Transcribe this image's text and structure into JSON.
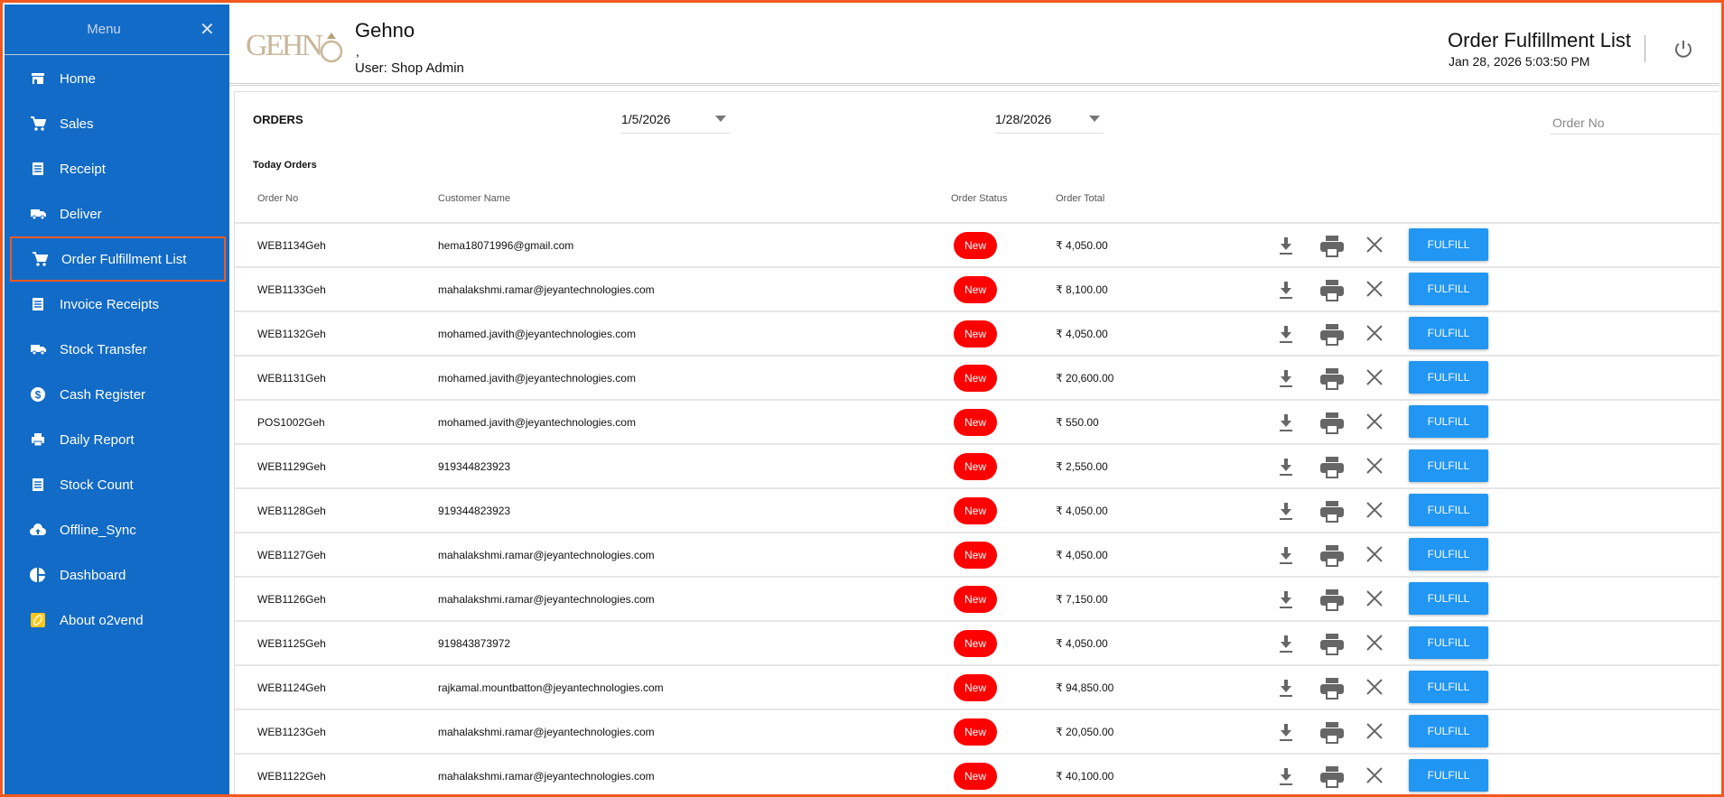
{
  "sidebar": {
    "title": "Menu",
    "close_icon": "close-icon",
    "items": [
      {
        "label": "Home",
        "icon": "store-icon"
      },
      {
        "label": "Sales",
        "icon": "cart-icon"
      },
      {
        "label": "Receipt",
        "icon": "receipt-icon"
      },
      {
        "label": "Deliver",
        "icon": "truck-icon"
      },
      {
        "label": "Order Fulfillment List",
        "icon": "cart-icon",
        "active": true
      },
      {
        "label": "Invoice Receipts",
        "icon": "receipt-icon"
      },
      {
        "label": "Stock Transfer",
        "icon": "truck-icon"
      },
      {
        "label": "Cash Register",
        "icon": "dollar-icon"
      },
      {
        "label": "Daily Report",
        "icon": "print-icon"
      },
      {
        "label": "Stock Count",
        "icon": "receipt-icon"
      },
      {
        "label": "Offline_Sync",
        "icon": "cloud-upload-icon"
      },
      {
        "label": "Dashboard",
        "icon": "pie-chart-icon"
      },
      {
        "label": "About o2vend",
        "icon": "o2vend-logo-icon"
      }
    ]
  },
  "header": {
    "logo_text": "GEHNO",
    "brand": "Gehno",
    "comma": ",",
    "user": "User:  Shop Admin",
    "page_title": "Order Fulfillment List",
    "datetime": "Jan 28, 2026 5:03:50 PM",
    "power_icon": "power-icon"
  },
  "filters": {
    "section_label": "ORDERS",
    "from_date": "1/5/2026",
    "to_date": "1/28/2026",
    "order_no_placeholder": "Order No"
  },
  "table": {
    "caption": "Today Orders",
    "columns": [
      "Order No",
      "Customer Name",
      "Order Status",
      "Order Total"
    ],
    "action_label": "FULFILL",
    "colors": {
      "status_new": "#ff0000",
      "fulfill": "#2196f3",
      "sidebar": "#126bc6",
      "highlight": "#f05a1e"
    },
    "rows": [
      {
        "order_no": "WEB1134Geh",
        "customer": "hema18071996@gmail.com",
        "status": "New",
        "total": "₹ 4,050.00"
      },
      {
        "order_no": "WEB1133Geh",
        "customer": "mahalakshmi.ramar@jeyantechnologies.com",
        "status": "New",
        "total": "₹ 8,100.00"
      },
      {
        "order_no": "WEB1132Geh",
        "customer": "mohamed.javith@jeyantechnologies.com",
        "status": "New",
        "total": "₹ 4,050.00"
      },
      {
        "order_no": "WEB1131Geh",
        "customer": "mohamed.javith@jeyantechnologies.com",
        "status": "New",
        "total": "₹ 20,600.00"
      },
      {
        "order_no": "POS1002Geh",
        "customer": "mohamed.javith@jeyantechnologies.com",
        "status": "New",
        "total": "₹ 550.00"
      },
      {
        "order_no": "WEB1129Geh",
        "customer": "919344823923",
        "status": "New",
        "total": "₹ 2,550.00"
      },
      {
        "order_no": "WEB1128Geh",
        "customer": "919344823923",
        "status": "New",
        "total": "₹ 4,050.00"
      },
      {
        "order_no": "WEB1127Geh",
        "customer": "mahalakshmi.ramar@jeyantechnologies.com",
        "status": "New",
        "total": "₹ 4,050.00"
      },
      {
        "order_no": "WEB1126Geh",
        "customer": "mahalakshmi.ramar@jeyantechnologies.com",
        "status": "New",
        "total": "₹ 7,150.00"
      },
      {
        "order_no": "WEB1125Geh",
        "customer": "919843873972",
        "status": "New",
        "total": "₹ 4,050.00"
      },
      {
        "order_no": "WEB1124Geh",
        "customer": "rajkamal.mountbatton@jeyantechnologies.com",
        "status": "New",
        "total": "₹ 94,850.00"
      },
      {
        "order_no": "WEB1123Geh",
        "customer": "mahalakshmi.ramar@jeyantechnologies.com",
        "status": "New",
        "total": "₹ 20,050.00"
      },
      {
        "order_no": "WEB1122Geh",
        "customer": "mahalakshmi.ramar@jeyantechnologies.com",
        "status": "New",
        "total": "₹ 40,100.00"
      }
    ]
  }
}
